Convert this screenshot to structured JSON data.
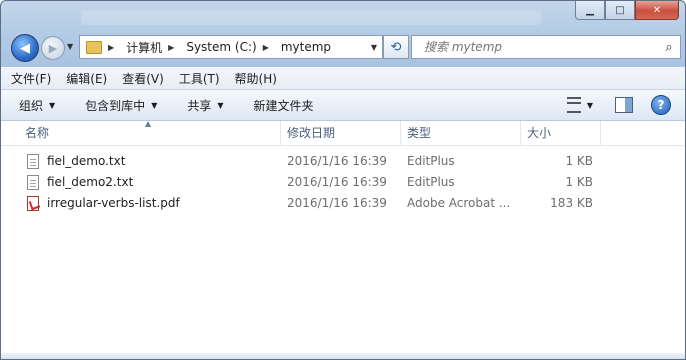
{
  "navigation": {
    "breadcrumbs": [
      "计算机",
      "System (C:)",
      "mytemp"
    ]
  },
  "search": {
    "placeholder": "搜索 mytemp"
  },
  "menu": [
    "文件(F)",
    "编辑(E)",
    "查看(V)",
    "工具(T)",
    "帮助(H)"
  ],
  "toolbar": {
    "organize": "组织",
    "include_library": "包含到库中",
    "share": "共享",
    "new_folder": "新建文件夹"
  },
  "columns": {
    "name": "名称",
    "date": "修改日期",
    "type": "类型",
    "size": "大小"
  },
  "files": [
    {
      "name": "fiel_demo.txt",
      "date": "2016/1/16 16:39",
      "type": "EditPlus",
      "size": "1 KB",
      "icon": "text-file-icon"
    },
    {
      "name": "fiel_demo2.txt",
      "date": "2016/1/16 16:39",
      "type": "EditPlus",
      "size": "1 KB",
      "icon": "text-file-icon"
    },
    {
      "name": "irregular-verbs-list.pdf",
      "date": "2016/1/16 16:39",
      "type": "Adobe Acrobat ...",
      "size": "183 KB",
      "icon": "pdf-file-icon"
    }
  ],
  "colors": {
    "frame": "#b4cce6",
    "close_button": "#c8503e",
    "header_text": "#4c607a"
  }
}
